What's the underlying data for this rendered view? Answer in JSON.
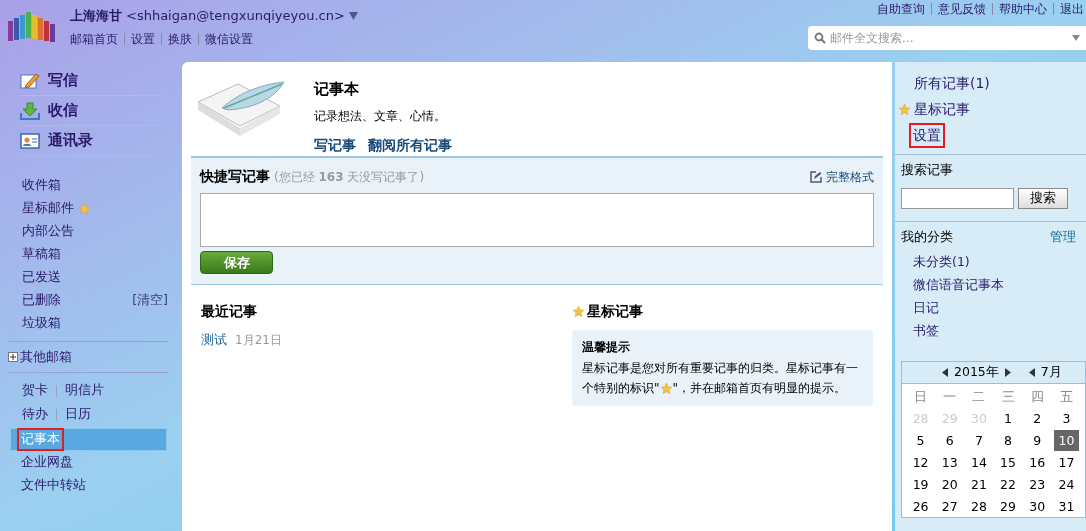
{
  "header": {
    "user_name": "上海海甘",
    "email": "<shhaigan@tengxunqiyeyou.cn>",
    "links": [
      "邮箱首页",
      "设置",
      "换肤",
      "微信设置"
    ],
    "top_links": [
      "自助查询",
      "意见反馈",
      "帮助中心",
      "退出"
    ],
    "search": {
      "placeholder": "邮件全文搜索..."
    }
  },
  "sidebar": {
    "actions": [
      {
        "label": "写信",
        "kind": "write"
      },
      {
        "label": "收信",
        "kind": "receive"
      },
      {
        "label": "通讯录",
        "kind": "contacts"
      }
    ],
    "folders": [
      {
        "label": "收件箱"
      },
      {
        "label": "星标邮件",
        "starred": true
      },
      {
        "label": "内部公告"
      },
      {
        "label": "草稿箱"
      },
      {
        "label": "已发送"
      },
      {
        "label": "已删除",
        "action": "[清空]"
      },
      {
        "label": "垃圾箱"
      }
    ],
    "other_mailboxes": {
      "label": "其他邮箱",
      "expanded": false
    },
    "tool_rows": [
      [
        "贺卡",
        "明信片"
      ],
      [
        "待办",
        "日历"
      ]
    ],
    "apps": [
      {
        "label": "记事本",
        "selected": true,
        "highlighted": true
      },
      {
        "label": "企业网盘",
        "selected": false,
        "highlighted": false
      },
      {
        "label": "文件中转站",
        "selected": false,
        "highlighted": false
      }
    ]
  },
  "notebook": {
    "title": "记事本",
    "description": "记录想法、文章、心情。",
    "links": [
      "写记事",
      "翻阅所有记事"
    ],
    "quick": {
      "title": "快捷写记事",
      "hint_before": "(您已经 ",
      "days": "163",
      "hint_after": " 天没写记事了)",
      "full_format": "完整格式",
      "save": "保存"
    },
    "recent": {
      "title": "最近记事",
      "items": [
        {
          "title": "测试",
          "date": "1月21日"
        }
      ]
    },
    "starred": {
      "title": "星标记事",
      "tip_title": "温馨提示",
      "tip_before": "星标记事是您对所有重要记事的归类。星标记事有一个特别的标识\"",
      "tip_after": "\"，并在邮箱首页有明显的提示。"
    }
  },
  "right_panel": {
    "links": [
      {
        "label": "所有记事(1)",
        "starred": false,
        "highlighted": false
      },
      {
        "label": "星标记事",
        "starred": true,
        "highlighted": false
      },
      {
        "label": "设置",
        "starred": false,
        "highlighted": true
      }
    ],
    "search": {
      "title": "搜索记事",
      "button": "搜索"
    },
    "categories": {
      "title": "我的分类",
      "manage": "管理",
      "items": [
        "未分类(1)",
        "微信语音记事本",
        "日记",
        "书签"
      ]
    },
    "calendar": {
      "year": "2015年",
      "month": "7月",
      "weekdays": [
        "日",
        "一",
        "二",
        "三",
        "四",
        "五"
      ],
      "weeks": [
        [
          {
            "day": "28",
            "muted": true,
            "selected": false
          },
          {
            "day": "29",
            "muted": true,
            "selected": false
          },
          {
            "day": "30",
            "muted": true,
            "selected": false
          },
          {
            "day": "1",
            "muted": false,
            "selected": false
          },
          {
            "day": "2",
            "muted": false,
            "selected": false
          },
          {
            "day": "3",
            "muted": false,
            "selected": false
          }
        ],
        [
          {
            "day": "5",
            "muted": false,
            "selected": false
          },
          {
            "day": "6",
            "muted": false,
            "selected": false
          },
          {
            "day": "7",
            "muted": false,
            "selected": false
          },
          {
            "day": "8",
            "muted": false,
            "selected": false
          },
          {
            "day": "9",
            "muted": false,
            "selected": false
          },
          {
            "day": "10",
            "muted": false,
            "selected": true
          }
        ],
        [
          {
            "day": "12",
            "muted": false,
            "selected": false
          },
          {
            "day": "13",
            "muted": false,
            "selected": false
          },
          {
            "day": "14",
            "muted": false,
            "selected": false
          },
          {
            "day": "15",
            "muted": false,
            "selected": false
          },
          {
            "day": "16",
            "muted": false,
            "selected": false
          },
          {
            "day": "17",
            "muted": false,
            "selected": false
          }
        ],
        [
          {
            "day": "19",
            "muted": false,
            "selected": false
          },
          {
            "day": "20",
            "muted": false,
            "selected": false
          },
          {
            "day": "21",
            "muted": false,
            "selected": false
          },
          {
            "day": "22",
            "muted": false,
            "selected": false
          },
          {
            "day": "23",
            "muted": false,
            "selected": false
          },
          {
            "day": "24",
            "muted": false,
            "selected": false
          }
        ],
        [
          {
            "day": "26",
            "muted": false,
            "selected": false
          },
          {
            "day": "27",
            "muted": false,
            "selected": false
          },
          {
            "day": "28",
            "muted": false,
            "selected": false
          },
          {
            "day": "29",
            "muted": false,
            "selected": false
          },
          {
            "day": "30",
            "muted": false,
            "selected": false
          },
          {
            "day": "31",
            "muted": false,
            "selected": false
          }
        ]
      ]
    }
  }
}
